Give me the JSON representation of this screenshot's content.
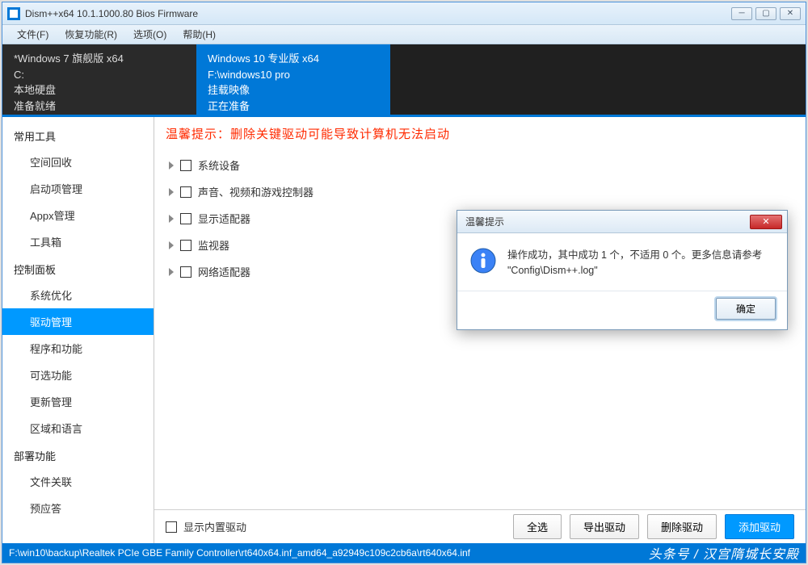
{
  "titlebar": {
    "text": "Dism++x64 10.1.1000.80 Bios Firmware"
  },
  "menu": {
    "file": "文件(F)",
    "recovery": "恢复功能(R)",
    "options": "选项(O)",
    "help": "帮助(H)"
  },
  "os_cards": [
    {
      "name": "*Windows 7 旗舰版 x64",
      "drive": "C:",
      "location": "本地硬盘",
      "status": "准备就绪"
    },
    {
      "name": "Windows 10 专业版 x64",
      "drive": "F:\\windows10 pro",
      "location": "挂载映像",
      "status": "正在准备"
    }
  ],
  "sidebar": {
    "groups": [
      {
        "label": "常用工具",
        "items": [
          {
            "label": "空间回收"
          },
          {
            "label": "启动项管理"
          },
          {
            "label": "Appx管理"
          },
          {
            "label": "工具箱"
          }
        ]
      },
      {
        "label": "控制面板",
        "items": [
          {
            "label": "系统优化"
          },
          {
            "label": "驱动管理",
            "selected": true
          },
          {
            "label": "程序和功能"
          },
          {
            "label": "可选功能"
          },
          {
            "label": "更新管理"
          },
          {
            "label": "区域和语言"
          }
        ]
      },
      {
        "label": "部署功能",
        "items": [
          {
            "label": "文件关联"
          },
          {
            "label": "预应答"
          }
        ]
      }
    ]
  },
  "warning_text": "温馨提示：删除关键驱动可能导致计算机无法启动",
  "tree": [
    {
      "label": "系统设备"
    },
    {
      "label": "声音、视频和游戏控制器"
    },
    {
      "label": "显示适配器"
    },
    {
      "label": "监视器"
    },
    {
      "label": "网络适配器"
    }
  ],
  "bottom": {
    "show_builtin": "显示内置驱动",
    "select_all": "全选",
    "export": "导出驱动",
    "delete": "删除驱动",
    "add": "添加驱动"
  },
  "status": {
    "path": "F:\\win10\\backup\\Realtek PCIe GBE Family Controller\\rt640x64.inf_amd64_a92949c109c2cb6a\\rt640x64.inf",
    "brand": "头条号 / 汉宫隋城长安殿"
  },
  "dialog": {
    "title": "温馨提示",
    "message": "操作成功，其中成功 1 个，不适用 0 个。更多信息请参考 \"Config\\Dism++.log\"",
    "ok": "确定"
  }
}
